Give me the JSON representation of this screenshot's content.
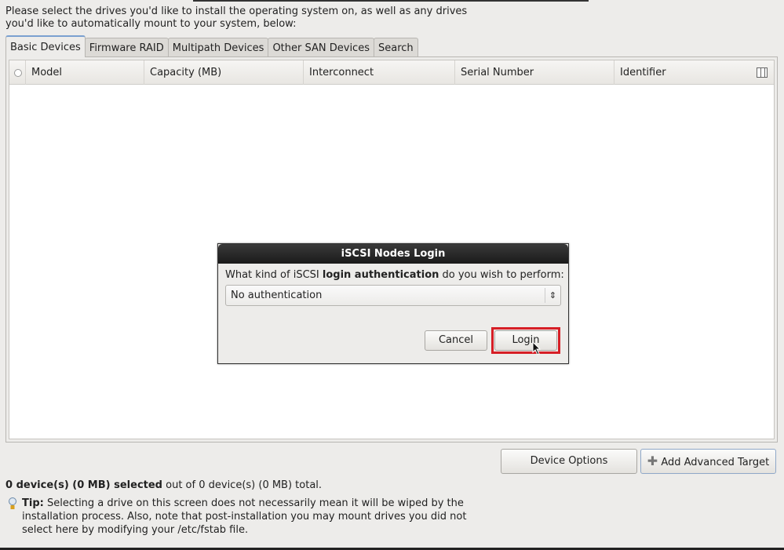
{
  "intro": {
    "line1": "Please select the drives you'd like to install the operating system on, as well as any drives",
    "line2": "you'd like to automatically mount to your system, below:"
  },
  "tabs": [
    {
      "label": "Basic Devices",
      "active": true
    },
    {
      "label": "Firmware RAID"
    },
    {
      "label": "Multipath Devices"
    },
    {
      "label": "Other SAN Devices"
    },
    {
      "label": "Search"
    }
  ],
  "table": {
    "columns": [
      "Model",
      "Capacity (MB)",
      "Interconnect",
      "Serial Number",
      "Identifier"
    ],
    "rows": []
  },
  "dialog": {
    "title": "iSCSI Nodes Login",
    "question_pre": "What kind of iSCSI ",
    "question_bold": "login authentication",
    "question_post": " do you wish to perform:",
    "auth_selected": "No authentication",
    "cancel": "Cancel",
    "login": "Login",
    "highlight_color": "#d61f26"
  },
  "buttons": {
    "device_options": "Device Options",
    "add_target": "Add Advanced Target"
  },
  "status": {
    "bold": "0 device(s) (0 MB) selected",
    "rest": " out of 0 device(s) (0 MB) total."
  },
  "tip": {
    "label": "Tip:",
    "text": " Selecting a drive on this screen does not necessarily mean it will be wiped by the installation process.  Also, note that post-installation you may mount drives you did not select here by modifying your /etc/fstab file."
  }
}
